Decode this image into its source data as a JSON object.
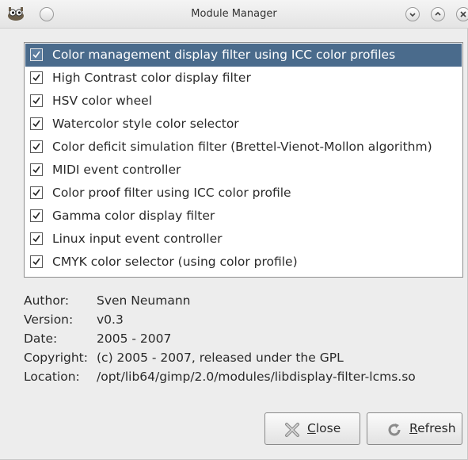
{
  "window": {
    "title": "Module Manager",
    "icon": "gimp-wilber-icon",
    "controls": [
      "minimize-icon",
      "maximize-icon",
      "close-icon"
    ]
  },
  "modules": [
    {
      "label": "Color management display filter using ICC color profiles",
      "checked": true,
      "selected": true
    },
    {
      "label": "High Contrast color display filter",
      "checked": true,
      "selected": false
    },
    {
      "label": "HSV color wheel",
      "checked": true,
      "selected": false
    },
    {
      "label": "Watercolor style color selector",
      "checked": true,
      "selected": false
    },
    {
      "label": "Color deficit simulation filter (Brettel-Vienot-Mollon algorithm)",
      "checked": true,
      "selected": false
    },
    {
      "label": "MIDI event controller",
      "checked": true,
      "selected": false
    },
    {
      "label": "Color proof filter using ICC color profile",
      "checked": true,
      "selected": false
    },
    {
      "label": "Gamma color display filter",
      "checked": true,
      "selected": false
    },
    {
      "label": "Linux input event controller",
      "checked": true,
      "selected": false
    },
    {
      "label": "CMYK color selector (using color profile)",
      "checked": true,
      "selected": false
    }
  ],
  "info": [
    {
      "key": "Author:",
      "value": "Sven Neumann"
    },
    {
      "key": "Version:",
      "value": "v0.3"
    },
    {
      "key": "Date:",
      "value": "2005 - 2007"
    },
    {
      "key": "Copyright:",
      "value": "(c) 2005 - 2007, released under the GPL"
    },
    {
      "key": "Location:",
      "value": "/opt/lib64/gimp/2.0/modules/libdisplay-filter-lcms.so"
    }
  ],
  "buttons": {
    "close": {
      "mnemonic": "C",
      "rest": "lose",
      "icon": "close-x-icon"
    },
    "refresh": {
      "mnemonic": "R",
      "rest": "efresh",
      "icon": "refresh-icon"
    }
  },
  "colors": {
    "selection": "#4a6b8c",
    "window_bg": "#ededed"
  }
}
